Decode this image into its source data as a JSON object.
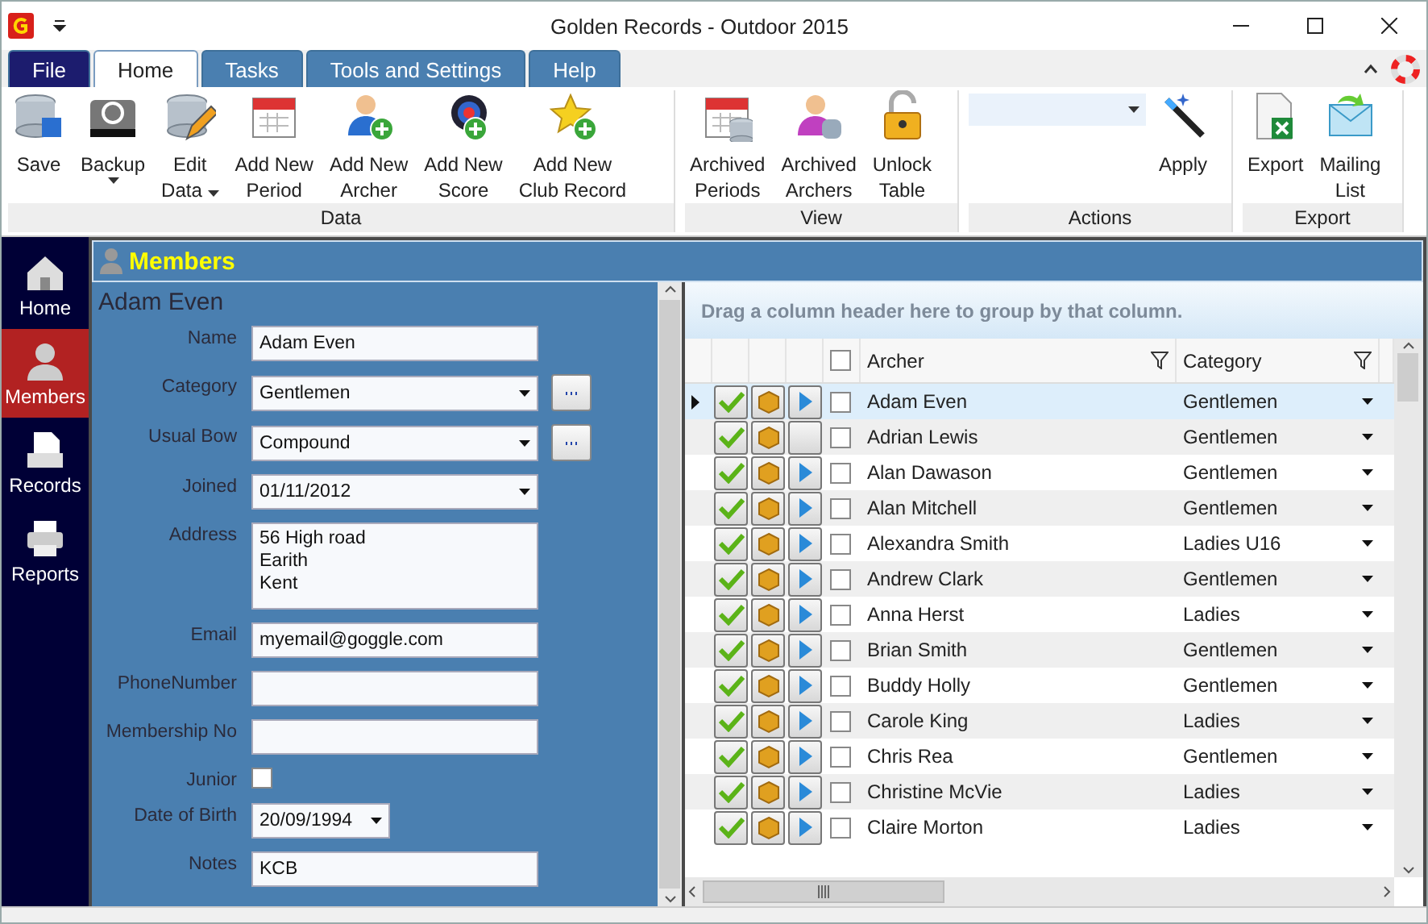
{
  "window": {
    "title": "Golden Records - Outdoor 2015"
  },
  "file_menu": {
    "label": "File"
  },
  "ribbon_tabs": [
    {
      "label": "Home",
      "selected": true
    },
    {
      "label": "Tasks",
      "selected": false
    },
    {
      "label": "Tools and Settings",
      "selected": false
    },
    {
      "label": "Help",
      "selected": false
    }
  ],
  "ribbon_groups": [
    {
      "label": "Data",
      "items": [
        {
          "kind": "button",
          "lines": [
            "Save"
          ],
          "dropdown": false
        },
        {
          "kind": "button",
          "lines": [
            "Backup"
          ],
          "dropdown": true
        },
        {
          "kind": "button",
          "lines": [
            "Edit",
            "Data"
          ],
          "dropdown": true
        },
        {
          "kind": "button",
          "lines": [
            "Add New",
            "Period"
          ],
          "dropdown": false
        },
        {
          "kind": "button",
          "lines": [
            "Add New",
            "Archer"
          ],
          "dropdown": false
        },
        {
          "kind": "button",
          "lines": [
            "Add New",
            "Score"
          ],
          "dropdown": false
        },
        {
          "kind": "button",
          "lines": [
            "Add New",
            "Club Record"
          ],
          "dropdown": false
        }
      ]
    },
    {
      "label": "View",
      "items": [
        {
          "kind": "button",
          "lines": [
            "Archived",
            "Periods"
          ],
          "dropdown": false
        },
        {
          "kind": "button",
          "lines": [
            "Archived",
            "Archers"
          ],
          "dropdown": false
        },
        {
          "kind": "button",
          "lines": [
            "Unlock",
            "Table"
          ],
          "dropdown": false
        }
      ]
    },
    {
      "label": "Actions",
      "items": [
        {
          "kind": "combo"
        },
        {
          "kind": "button",
          "lines": [
            "Apply"
          ],
          "dropdown": false
        }
      ]
    },
    {
      "label": "Export",
      "items": [
        {
          "kind": "button",
          "lines": [
            "Export"
          ],
          "dropdown": false
        },
        {
          "kind": "button",
          "lines": [
            "Mailing",
            "List"
          ],
          "dropdown": false
        }
      ]
    }
  ],
  "nav": [
    {
      "label": "Home",
      "selected": false
    },
    {
      "label": "Members",
      "selected": true
    },
    {
      "label": "Records",
      "selected": false
    },
    {
      "label": "Reports",
      "selected": false
    }
  ],
  "members": {
    "title": "Members",
    "record_heading": "Adam Even",
    "fields": [
      {
        "label": "Name",
        "kind": "text",
        "value": "Adam Even"
      },
      {
        "label": "Category",
        "kind": "select",
        "value": "Gentlemen",
        "browse": true
      },
      {
        "label": "Usual Bow",
        "kind": "select",
        "value": "Compound",
        "browse": true
      },
      {
        "label": "Joined",
        "kind": "select",
        "value": "01/11/2012",
        "browse": false
      },
      {
        "label": "Address",
        "kind": "multiline",
        "lines": [
          "56 High road",
          "Earith",
          "Kent"
        ]
      },
      {
        "label": "Email",
        "kind": "text",
        "value": "myemail@goggle.com"
      },
      {
        "label": "PhoneNumber",
        "kind": "text"
      },
      {
        "label": "Membership No",
        "kind": "text"
      },
      {
        "label": "Junior",
        "kind": "checkbox",
        "checked": false
      },
      {
        "label": "Date of Birth",
        "kind": "date",
        "value": "20/09/1994"
      },
      {
        "label": "Notes",
        "kind": "text",
        "value": "KCB"
      }
    ]
  },
  "grid": {
    "group_hint": "Drag a column header here to group by that column.",
    "select_all_checked": false,
    "columns": [
      {
        "label": "Archer"
      },
      {
        "label": "Category"
      }
    ],
    "rows": [
      {
        "archer": "Adam Even",
        "category": "Gentlemen",
        "selected": true,
        "checked": false,
        "arrow": true
      },
      {
        "archer": "Adrian Lewis",
        "category": "Gentlemen",
        "selected": false,
        "checked": false,
        "arrow": false
      },
      {
        "archer": "Alan Dawason",
        "category": "Gentlemen",
        "selected": false,
        "checked": false,
        "arrow": true
      },
      {
        "archer": "Alan Mitchell",
        "category": "Gentlemen",
        "selected": false,
        "checked": false,
        "arrow": true
      },
      {
        "archer": "Alexandra Smith",
        "category": "Ladies U16",
        "selected": false,
        "checked": false,
        "arrow": true
      },
      {
        "archer": "Andrew Clark",
        "category": "Gentlemen",
        "selected": false,
        "checked": false,
        "arrow": true
      },
      {
        "archer": "Anna Herst",
        "category": "Ladies",
        "selected": false,
        "checked": false,
        "arrow": true
      },
      {
        "archer": "Brian Smith",
        "category": "Gentlemen",
        "selected": false,
        "checked": false,
        "arrow": true
      },
      {
        "archer": "Buddy Holly",
        "category": "Gentlemen",
        "selected": false,
        "checked": false,
        "arrow": true
      },
      {
        "archer": "Carole King",
        "category": "Ladies",
        "selected": false,
        "checked": false,
        "arrow": true
      },
      {
        "archer": "Chris Rea",
        "category": "Gentlemen",
        "selected": false,
        "checked": false,
        "arrow": true
      },
      {
        "archer": "Christine McVie",
        "category": "Ladies",
        "selected": false,
        "checked": false,
        "arrow": true
      },
      {
        "archer": "Claire Morton",
        "category": "Ladies",
        "selected": false,
        "checked": false,
        "arrow": true
      }
    ]
  }
}
